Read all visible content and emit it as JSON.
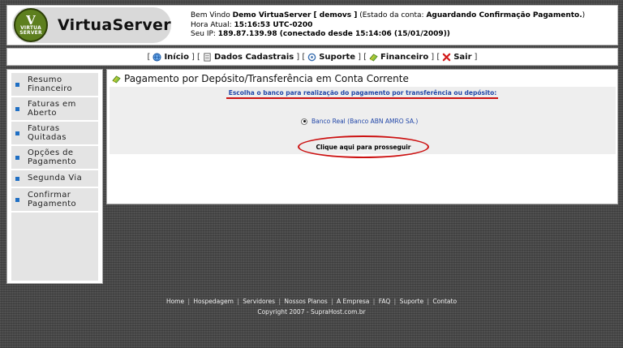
{
  "header": {
    "logo_name": "VirtuaServer",
    "logo_badge_letter": "V",
    "logo_badge_text1": "VIRTUA",
    "logo_badge_text2": "SERVER",
    "welcome_prefix": "Bem Vindo ",
    "user_name": "Demo VirtuaServer [ demovs ]",
    "account_state_prefix": " (Estado da conta: ",
    "account_state": "Aguardando Confirmação Pagamento.",
    "account_state_suffix": ")",
    "time_label": "Hora Atual: ",
    "time_value": "15:16:53 UTC-0200",
    "ip_label": "Seu IP: ",
    "ip_value": "189.87.139.98 (conectado desde 15:14:06 (15/01/2009))"
  },
  "nav": {
    "open": "[",
    "close": "]",
    "items": [
      {
        "label": "Início",
        "icon": "home-globe-icon"
      },
      {
        "label": "Dados Cadastrais",
        "icon": "document-icon"
      },
      {
        "label": "Suporte",
        "icon": "support-icon"
      },
      {
        "label": "Financeiro",
        "icon": "money-icon"
      },
      {
        "label": "Sair",
        "icon": "exit-x-icon"
      }
    ],
    "separator": "] ["
  },
  "sidebar": {
    "items": [
      {
        "line1": "Resumo",
        "line2": "Financeiro"
      },
      {
        "line1": "Faturas em",
        "line2": "Aberto"
      },
      {
        "line1": "Faturas",
        "line2": "Quitadas"
      },
      {
        "line1": "Opções de",
        "line2": "Pagamento"
      },
      {
        "line1": "Segunda Via",
        "line2": ""
      },
      {
        "line1": "Confirmar",
        "line2": "Pagamento"
      }
    ]
  },
  "main": {
    "title": "Pagamento por Depósito/Transferência em Conta Corrente",
    "instruction": "Escolha o banco para realização do pagamento por transferência ou depósito:",
    "bank_option": "Banco Real (Banco ABN AMRO SA.)",
    "proceed_label": "Clique aqui para prosseguir"
  },
  "footer": {
    "links": [
      "Home",
      "Hospedagem",
      "Servidores",
      "Nossos Planos",
      "A Empresa",
      "FAQ",
      "Suporte",
      "Contato"
    ],
    "separator": "|",
    "copyright": "Copyright 2007 - SupraHost.com.br"
  },
  "colors": {
    "sidebar_bullet": "#1f6fc4",
    "link_blue": "#2146a8",
    "highlight_red": "#cc1111",
    "logo_green": "#5d7f1e"
  }
}
